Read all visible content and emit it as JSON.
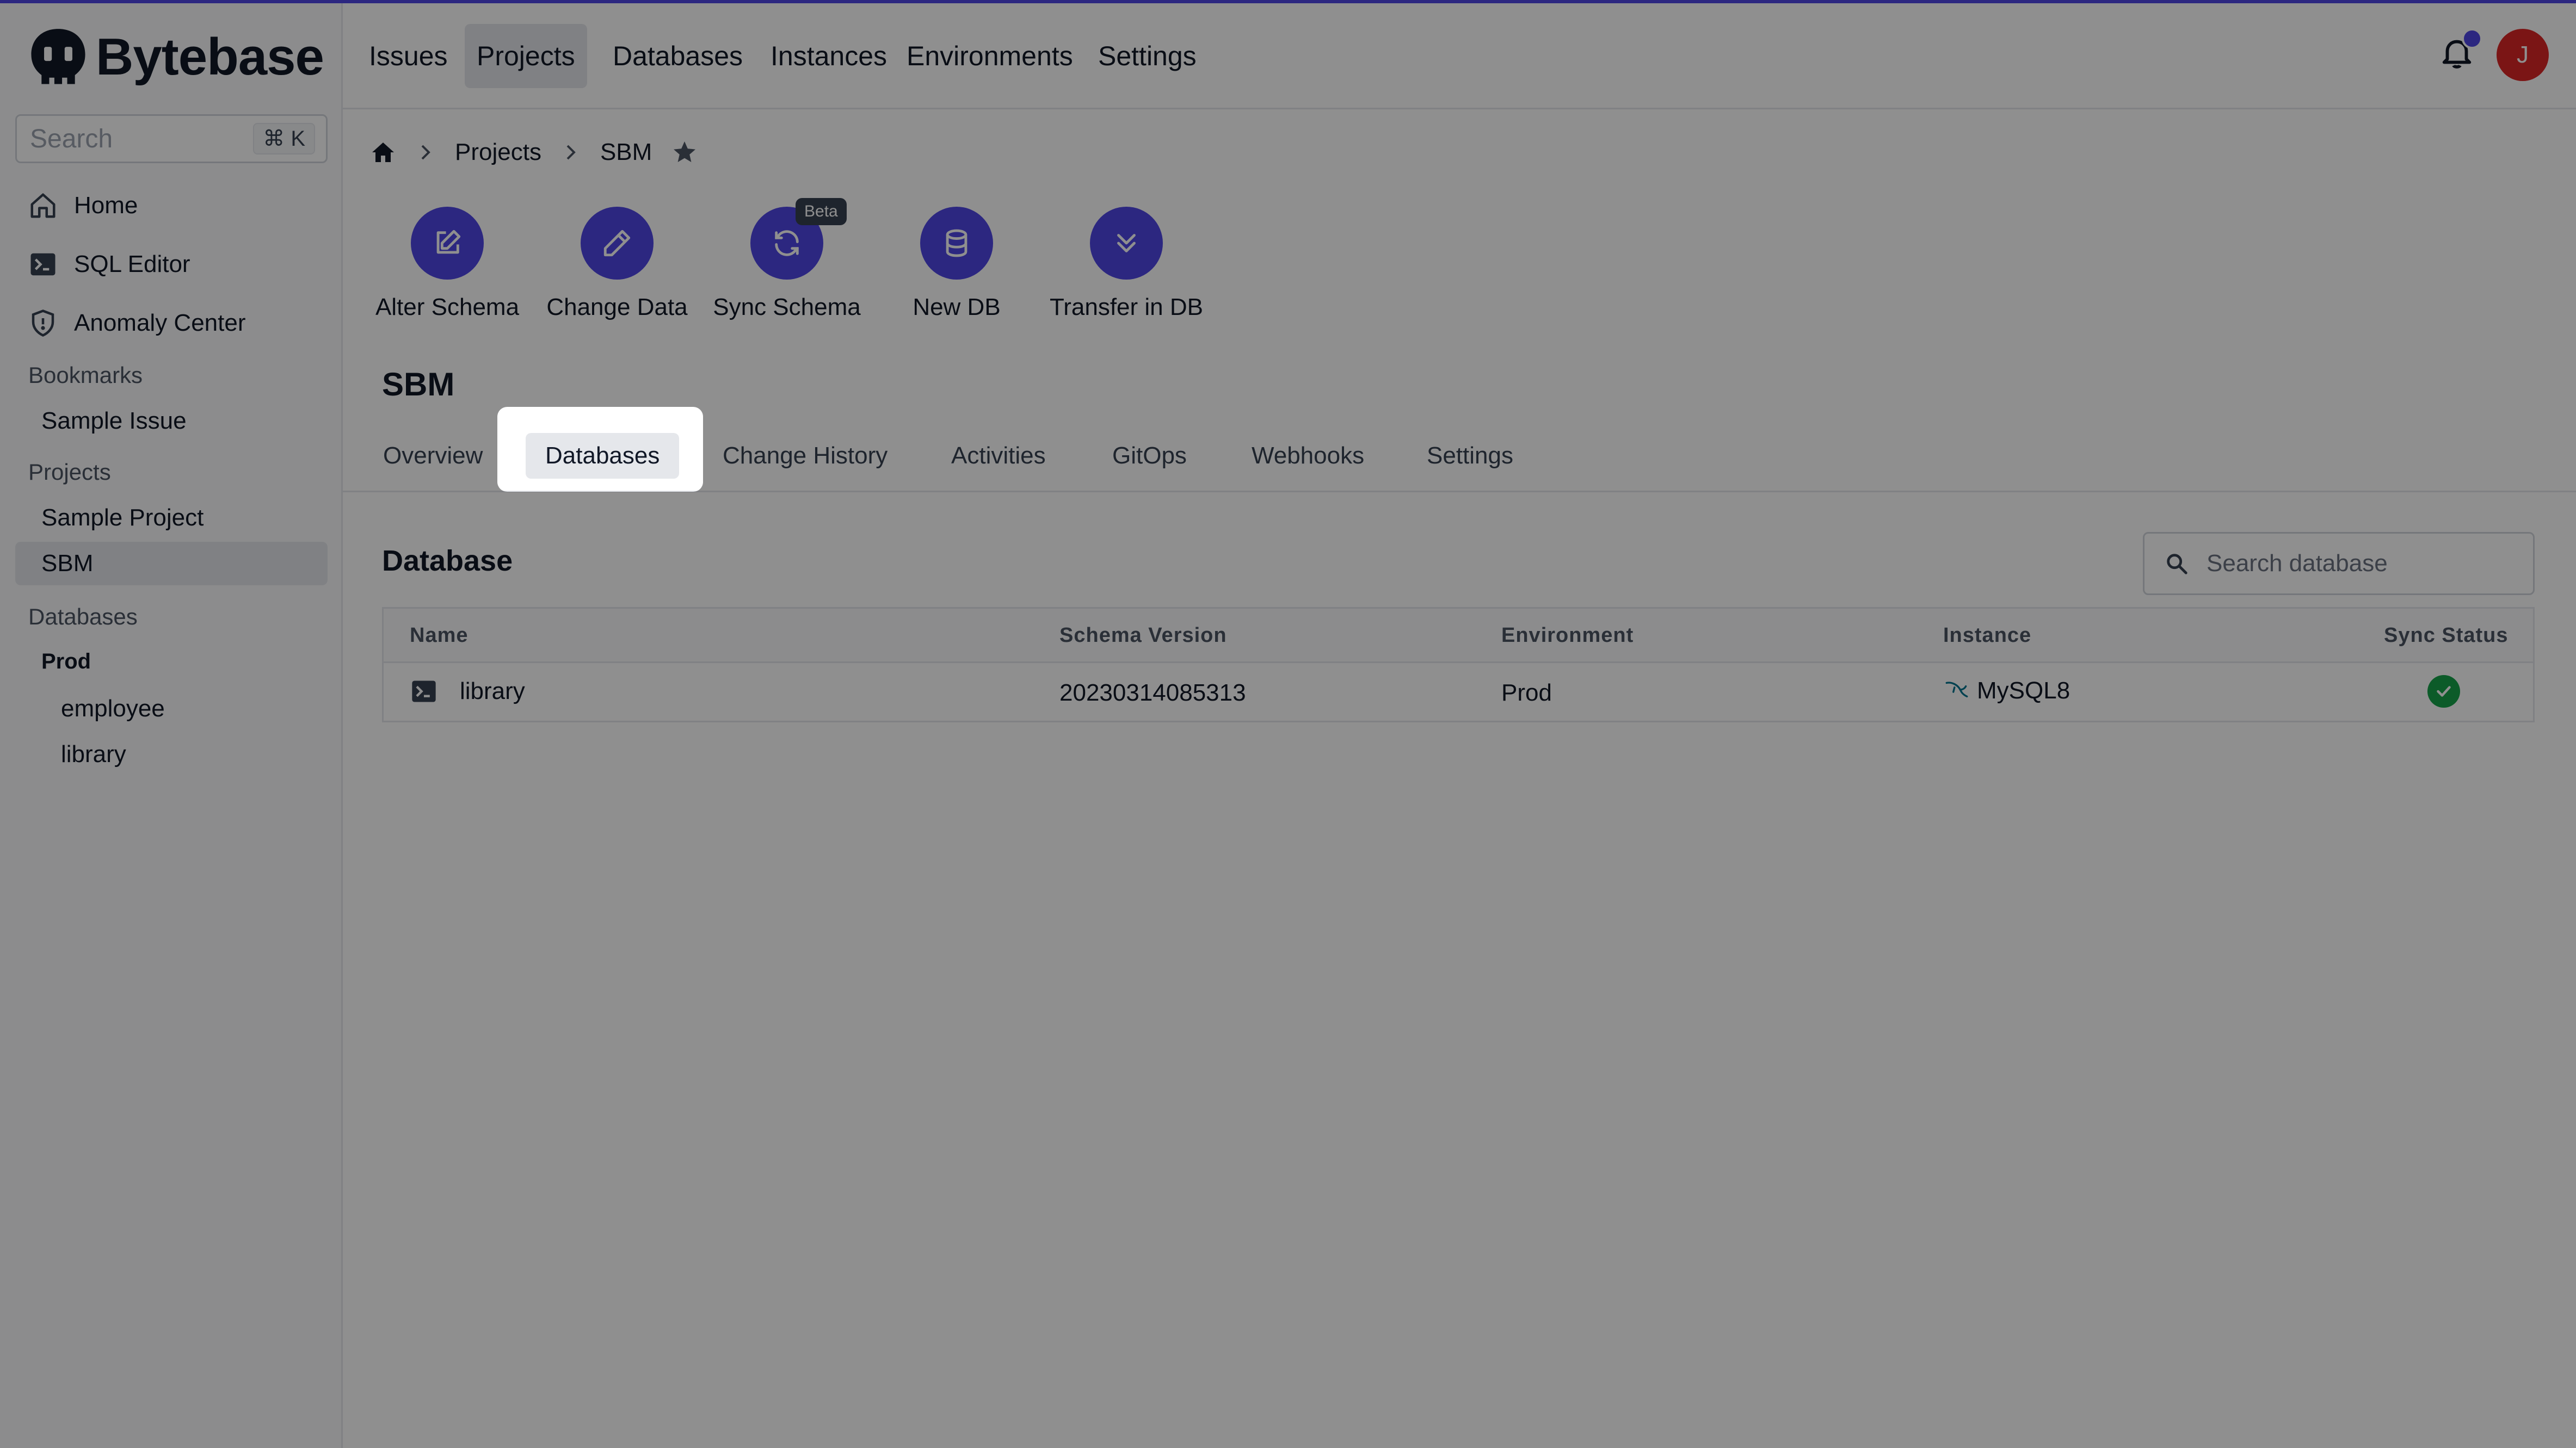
{
  "app": {
    "name": "Bytebase"
  },
  "sidebar": {
    "search_placeholder": "Search",
    "search_shortcut": "⌘ K",
    "nav": [
      {
        "label": "Home",
        "icon": "home-icon"
      },
      {
        "label": "SQL Editor",
        "icon": "terminal-icon"
      },
      {
        "label": "Anomaly Center",
        "icon": "shield-icon"
      }
    ],
    "bookmarks_label": "Bookmarks",
    "bookmarks": [
      {
        "label": "Sample Issue"
      }
    ],
    "projects_label": "Projects",
    "projects": [
      {
        "label": "Sample Project"
      },
      {
        "label": "SBM",
        "active": true
      }
    ],
    "databases_label": "Databases",
    "environment_label": "Prod",
    "databases": [
      {
        "label": "employee"
      },
      {
        "label": "library"
      }
    ]
  },
  "header": {
    "tabs": [
      {
        "label": "Issues"
      },
      {
        "label": "Projects",
        "active": true
      },
      {
        "label": "Databases"
      },
      {
        "label": "Instances"
      },
      {
        "label": "Environments"
      },
      {
        "label": "Settings"
      }
    ],
    "avatar_initial": "J"
  },
  "breadcrumb": {
    "projects": "Projects",
    "current": "SBM"
  },
  "quick_actions": [
    {
      "label": "Alter Schema",
      "icon": "edit-icon"
    },
    {
      "label": "Change Data",
      "icon": "pencil-icon"
    },
    {
      "label": "Sync Schema",
      "icon": "sync-icon",
      "badge": "Beta"
    },
    {
      "label": "New DB",
      "icon": "database-icon"
    },
    {
      "label": "Transfer in DB",
      "icon": "chevrons-down-icon"
    }
  ],
  "project": {
    "title": "SBM",
    "tabs": [
      {
        "label": "Overview"
      },
      {
        "label": "Databases",
        "active": true
      },
      {
        "label": "Change History"
      },
      {
        "label": "Activities"
      },
      {
        "label": "GitOps"
      },
      {
        "label": "Webhooks"
      },
      {
        "label": "Settings"
      }
    ]
  },
  "database_section": {
    "title": "Database",
    "search_placeholder": "Search database",
    "columns": [
      "Name",
      "Schema Version",
      "Environment",
      "Instance",
      "Sync Status"
    ],
    "rows": [
      {
        "name": "library",
        "schema_version": "20230314085313",
        "environment": "Prod",
        "instance": "MySQL8",
        "sync_status": "ok"
      }
    ]
  },
  "colors": {
    "accent": "#4f46e5",
    "success": "#16a34a",
    "avatar": "#dc2626"
  }
}
